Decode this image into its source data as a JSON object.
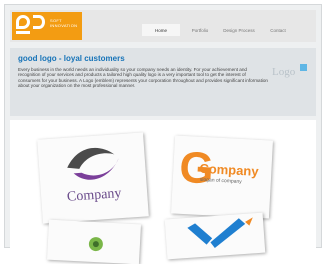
{
  "header": {
    "brand_text": "SOFT INNOVATION",
    "nav": [
      {
        "label": "Home",
        "active": true
      },
      {
        "label": "Portfolio",
        "active": false
      },
      {
        "label": "Design Process",
        "active": false
      },
      {
        "label": "Contact",
        "active": false
      }
    ]
  },
  "intro": {
    "title": "good logo - loyal customers",
    "body": "Every business in the world needs an individuality so your company needs an identity. For your achievement and recognition of your services and products a tailored high quality logo is a very important tool to get the interest of consumers for your business. A Logo (emblem) represents your corporation throughout and provides significant information about your organization on the most professional manner.",
    "side_logo": "Logo"
  },
  "showcase": {
    "card1": {
      "text": "Company"
    },
    "card2": {
      "letter": "G",
      "text": "Company",
      "slogan": "slogan of company"
    }
  },
  "colors": {
    "brand_orange": "#f39c12",
    "title_blue": "#1673b8",
    "company_purple": "#6a4b8b",
    "accent_green": "#7ab648",
    "accent_blue": "#1f7fd0"
  }
}
